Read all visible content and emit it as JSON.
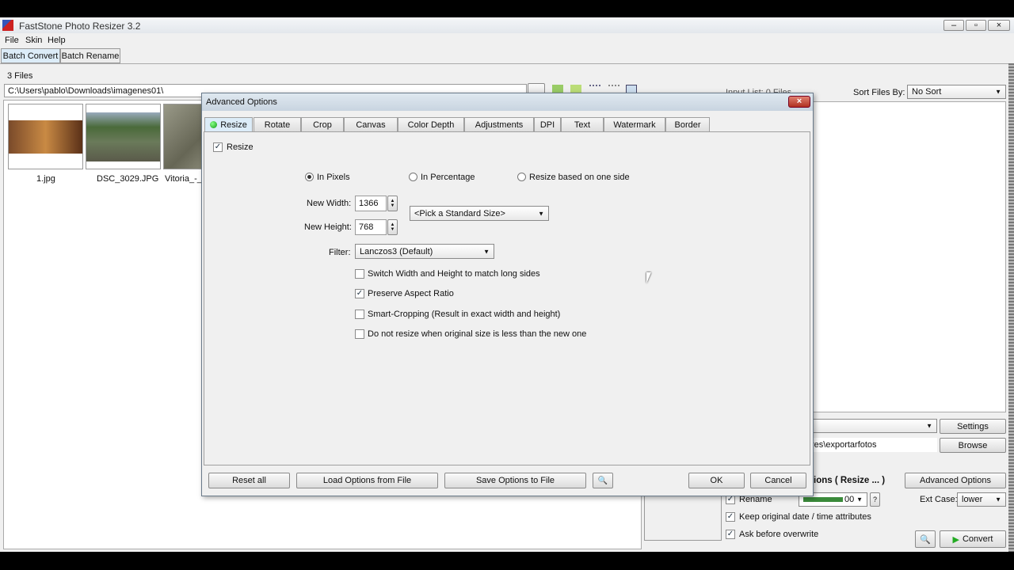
{
  "app": {
    "title": "FastStone Photo Resizer 3.2"
  },
  "menu": [
    "File",
    "Skin",
    "Help"
  ],
  "main_tabs": [
    "Batch Convert",
    "Batch Rename"
  ],
  "file_count": "3 Files",
  "path": "C:\\Users\\pablo\\Downloads\\imagenes01\\",
  "thumbnails": [
    "1.jpg",
    "DSC_3029.JPG",
    "Vitoria_-_"
  ],
  "input_list_label": "Input List: 0 Files",
  "sort": {
    "label": "Sort Files By:",
    "value": "No Sort"
  },
  "output": {
    "settings": "Settings",
    "folder": "res\\exportarfotos",
    "browse": "Browse",
    "advanced_label": "ions ( Resize ... )",
    "advanced_button": "Advanced Options",
    "rename": "Rename",
    "rename_pattern": "00",
    "help": "?",
    "ext_case_label": "Ext Case:",
    "ext_case_value": "lower",
    "keep_date": "Keep original date / time attributes",
    "ask_overwrite": "Ask before overwrite",
    "convert": "Convert"
  },
  "dialog": {
    "title": "Advanced Options",
    "tabs": [
      "Resize",
      "Rotate",
      "Crop",
      "Canvas",
      "Color Depth",
      "Adjustments",
      "DPI",
      "Text",
      "Watermark",
      "Border"
    ],
    "resize_check": "Resize",
    "modes": [
      "In Pixels",
      "In Percentage",
      "Resize based on one side"
    ],
    "width_label": "New Width:",
    "width": "1366",
    "height_label": "New Height:",
    "height": "768",
    "standard_size": "<Pick a Standard Size>",
    "filter_label": "Filter:",
    "filter": "Lanczos3 (Default)",
    "options": [
      {
        "label": "Switch Width and Height to match long sides",
        "checked": false
      },
      {
        "label": "Preserve Aspect Ratio",
        "checked": true
      },
      {
        "label": "Smart-Cropping (Result in exact width and height)",
        "checked": false
      },
      {
        "label": "Do not resize when original size is less than the new one",
        "checked": false
      }
    ],
    "buttons": {
      "reset": "Reset all",
      "load": "Load Options from File",
      "save": "Save Options to File",
      "ok": "OK",
      "cancel": "Cancel"
    }
  }
}
